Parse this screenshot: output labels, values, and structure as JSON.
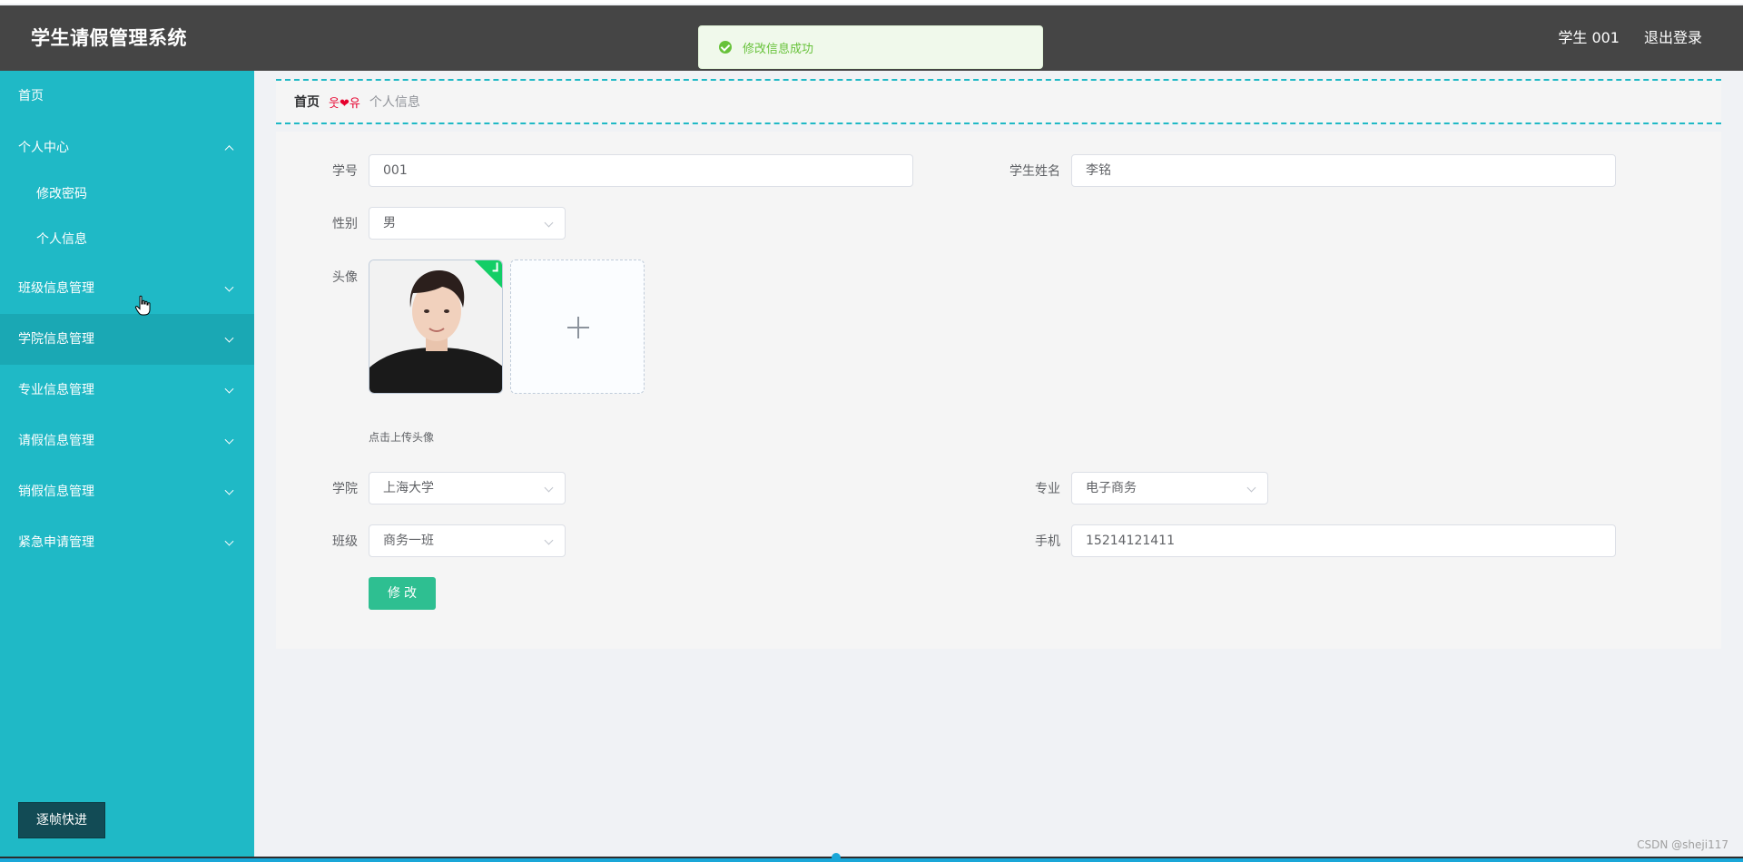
{
  "header": {
    "app_title": "学生请假管理系统",
    "user_label": "学生 001",
    "logout_label": "退出登录"
  },
  "toast": {
    "message": "修改信息成功",
    "color": "#67c23a"
  },
  "sidebar": {
    "bg_color": "#1fb9c6",
    "items": [
      {
        "label": "首页"
      },
      {
        "label": "个人中心",
        "expanded": true
      },
      {
        "label": "修改密码"
      },
      {
        "label": "个人信息"
      },
      {
        "label": "班级信息管理"
      },
      {
        "label": "学院信息管理"
      },
      {
        "label": "专业信息管理"
      },
      {
        "label": "请假信息管理"
      },
      {
        "label": "销假信息管理"
      },
      {
        "label": "紧急申请管理"
      }
    ],
    "quick_button_label": "逐帧快进"
  },
  "breadcrumb": {
    "home": "首页",
    "separator": "웃❤유",
    "current": "个人信息"
  },
  "form": {
    "student_no": {
      "label": "学号",
      "value": "001"
    },
    "student_name": {
      "label": "学生姓名",
      "value": "李铭"
    },
    "gender": {
      "label": "性别",
      "value": "男"
    },
    "avatar": {
      "label": "头像",
      "upload_tip": "点击上传头像"
    },
    "college": {
      "label": "学院",
      "value": "上海大学"
    },
    "major": {
      "label": "专业",
      "value": "电子商务"
    },
    "class": {
      "label": "班级",
      "value": "商务一班"
    },
    "phone": {
      "label": "手机",
      "value": "15214121411"
    },
    "submit_label": "修改",
    "submit_color": "#2ebf91"
  },
  "watermark": "CSDN @sheji117"
}
